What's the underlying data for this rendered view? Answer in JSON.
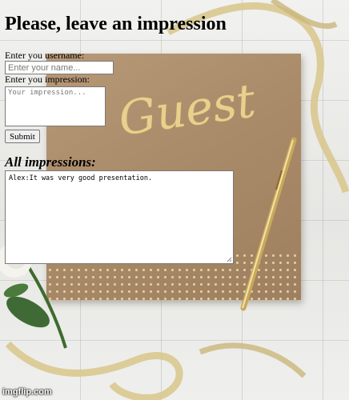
{
  "page": {
    "title": "Please, leave an impression"
  },
  "form": {
    "username_label": "Enter you username:",
    "username_placeholder": "Enter your name...",
    "impression_label": "Enter you impression:",
    "impression_placeholder": "Your impression...",
    "submit_label": "Submit"
  },
  "impressions": {
    "heading": "All impressions:",
    "content": "Alex:It was very good presentation."
  },
  "background": {
    "book_title": "Guest"
  },
  "watermark": "imgflip.com",
  "colors": {
    "book": "#a98a68",
    "gold": "#e9d08d",
    "background": "#ececea"
  }
}
